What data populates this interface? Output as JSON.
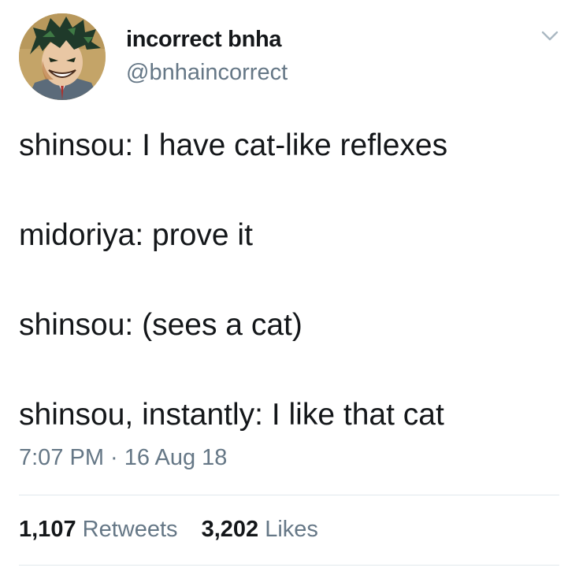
{
  "author": {
    "display_name": "incorrect bnha",
    "handle": "@bnhaincorrect",
    "avatar_icon": "anime-character-avatar"
  },
  "menu": {
    "icon": "chevron-down-icon"
  },
  "tweet": {
    "lines": [
      "shinsou: I have cat-like reflexes",
      "midoriya: prove it",
      "shinsou: (sees a cat)",
      "shinsou, instantly: I like that cat"
    ],
    "timestamp": "7:07 PM · 16 Aug 18"
  },
  "stats": {
    "retweets": {
      "count": "1,107",
      "label": "Retweets"
    },
    "likes": {
      "count": "3,202",
      "label": "Likes"
    }
  },
  "colors": {
    "text": "#14171a",
    "secondary": "#657786",
    "divider": "#e1e8ed"
  }
}
